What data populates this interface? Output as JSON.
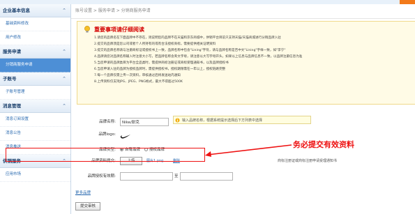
{
  "sidebar": {
    "sections": [
      {
        "title": "企业基本信息",
        "items": [
          "基础资料修改",
          "用户修改"
        ]
      },
      {
        "title": "服务申请",
        "items": [
          "分销商服务申请"
        ]
      },
      {
        "title": "子账号",
        "items": [
          "子账号管理"
        ]
      },
      {
        "title": "消息管理",
        "items": [
          "消息订阅设置",
          "消息公告",
          "消息推送"
        ]
      },
      {
        "title": "供销服务",
        "items": [
          "应用市场"
        ]
      }
    ],
    "active": "分销商服务申请"
  },
  "breadcrumb": "账号设置 > 服务申请 > 分销商服务申请",
  "notice": {
    "title": "重要事项请仔细阅读",
    "lines": [
      "1.请您的品牌名在下面品牌中不存在，则说明您的品牌不在天猫和京东商城中，供销平台目前只支持天猫/天猫商城进行分销品牌入驻",
      "2.提交的品牌须是您公司或者个人所持有的或有合法授权商标，需要提供相关证明资料",
      "3.提交的品牌名称请与注册商标证或授权书上一致，品牌名称中包含\"Lining\"字符，请与品牌名称是否中文\"Lining\"字样一致，如\"李宁\"",
      "4.品牌请您对品牌名称输入时注意大小写，若品牌名称含英文字母，请注意以大写字母开头，如果以上信息与品牌信息不一致，以品牌注册信息为准",
      "5.当您申请的品牌类目为平台全品类时，需提供商标注册证或商标受理通知书，以及品牌授权书",
      "6.当您申请入驻的品牌为授权品牌时，需提供授权书，授权期限需在一年以上，授权链路完整",
      "7.每一个品牌仅需上传一次资料，审核通过后将发送站内通知",
      "8.上传资料仅支持JPG、JPEG、PNG格式，最大不得超过500K"
    ]
  },
  "form": {
    "brand_name_label": "品牌名称:",
    "brand_name_value": "Nike/耐克",
    "tip": "输入品牌名称，根据系统提示选择后下方列表中选择",
    "brand_logo_label": "品牌logo:",
    "brand_type_label": "品牌类型:",
    "brand_type_options": [
      "自有品牌",
      "授权品牌"
    ],
    "brand_type_selected": "自有品牌",
    "upload_label": "品牌资料提交:",
    "upload_button": "上传",
    "uploaded_file": "图片1.png",
    "delete_link": "删除",
    "upload_hint": "商标注册证或商标注册申请受理通知书",
    "period_label": "品牌授权有效期:",
    "period_sep": "至",
    "more_link": "更多品牌",
    "submit_button": "提交审核"
  },
  "annotation": "务必提交有效资料",
  "colors": {
    "accent": "#4d8fd6",
    "annotation": "#e11111",
    "notice_bg": "#fffbe6"
  }
}
